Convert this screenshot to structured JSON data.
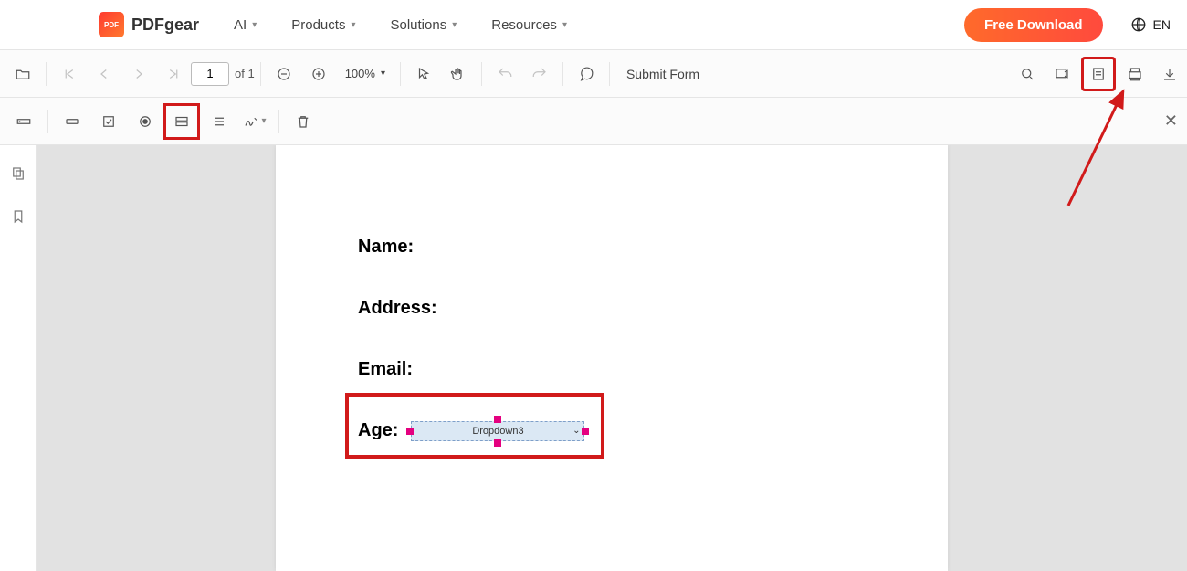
{
  "brand": {
    "name": "PDFgear",
    "logo_text": "PDF"
  },
  "menu": {
    "ai": "AI",
    "products": "Products",
    "solutions": "Solutions",
    "resources": "Resources"
  },
  "download_btn": "Free Download",
  "lang": "EN",
  "toolbar": {
    "page_input": "1",
    "page_total": "of 1",
    "zoom": "100%",
    "submit": "Submit Form"
  },
  "doc": {
    "name_label": "Name:",
    "address_label": "Address:",
    "email_label": "Email:",
    "age_label": "Age:",
    "dropdown_name": "Dropdown3"
  }
}
